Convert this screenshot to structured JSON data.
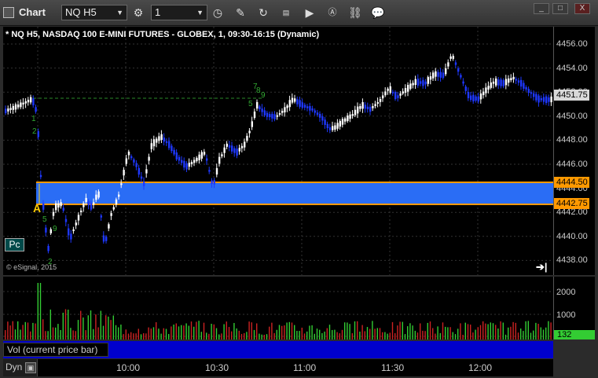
{
  "titlebar": {
    "title": "Chart",
    "symbol_field": "NQ H5",
    "interval_field": "1",
    "window_buttons": [
      "_",
      "□",
      "X"
    ]
  },
  "chart": {
    "header": "* NQ H5, NASDAQ 100 E-MINI FUTURES - GLOBEX, 1, 09:30-16:15 (Dynamic)",
    "watermark": "© eSignal, 2015",
    "pc_button": "Pc",
    "marker_label": "A",
    "price_axis": [
      "4456.00",
      "4454.00",
      "4452.00",
      "4450.00",
      "4448.00",
      "4446.00",
      "4444.00",
      "4442.00",
      "4440.00",
      "4438.00"
    ],
    "tags": {
      "last": "4451.75",
      "zone_high": "4444.50",
      "zone_low": "4442.75"
    },
    "colors": {
      "up": "#ffffff",
      "down": "#1e38ff",
      "zone": "#2a6df5",
      "zone_border": "#ff9900",
      "vol_up": "#33cc33",
      "vol_down": "#cc2222",
      "label_bar": "#0000cc"
    },
    "annotations": [
      "1",
      "2",
      "5",
      "9",
      "7",
      "8",
      "9",
      "5",
      "2"
    ]
  },
  "volume": {
    "label": "Vol (current price bar)",
    "axis": [
      "2000",
      "1000"
    ],
    "current": "132"
  },
  "time_axis": {
    "mode": "Dyn",
    "labels": [
      "10:00",
      "10:30",
      "11:00",
      "11:30",
      "12:00"
    ]
  }
}
